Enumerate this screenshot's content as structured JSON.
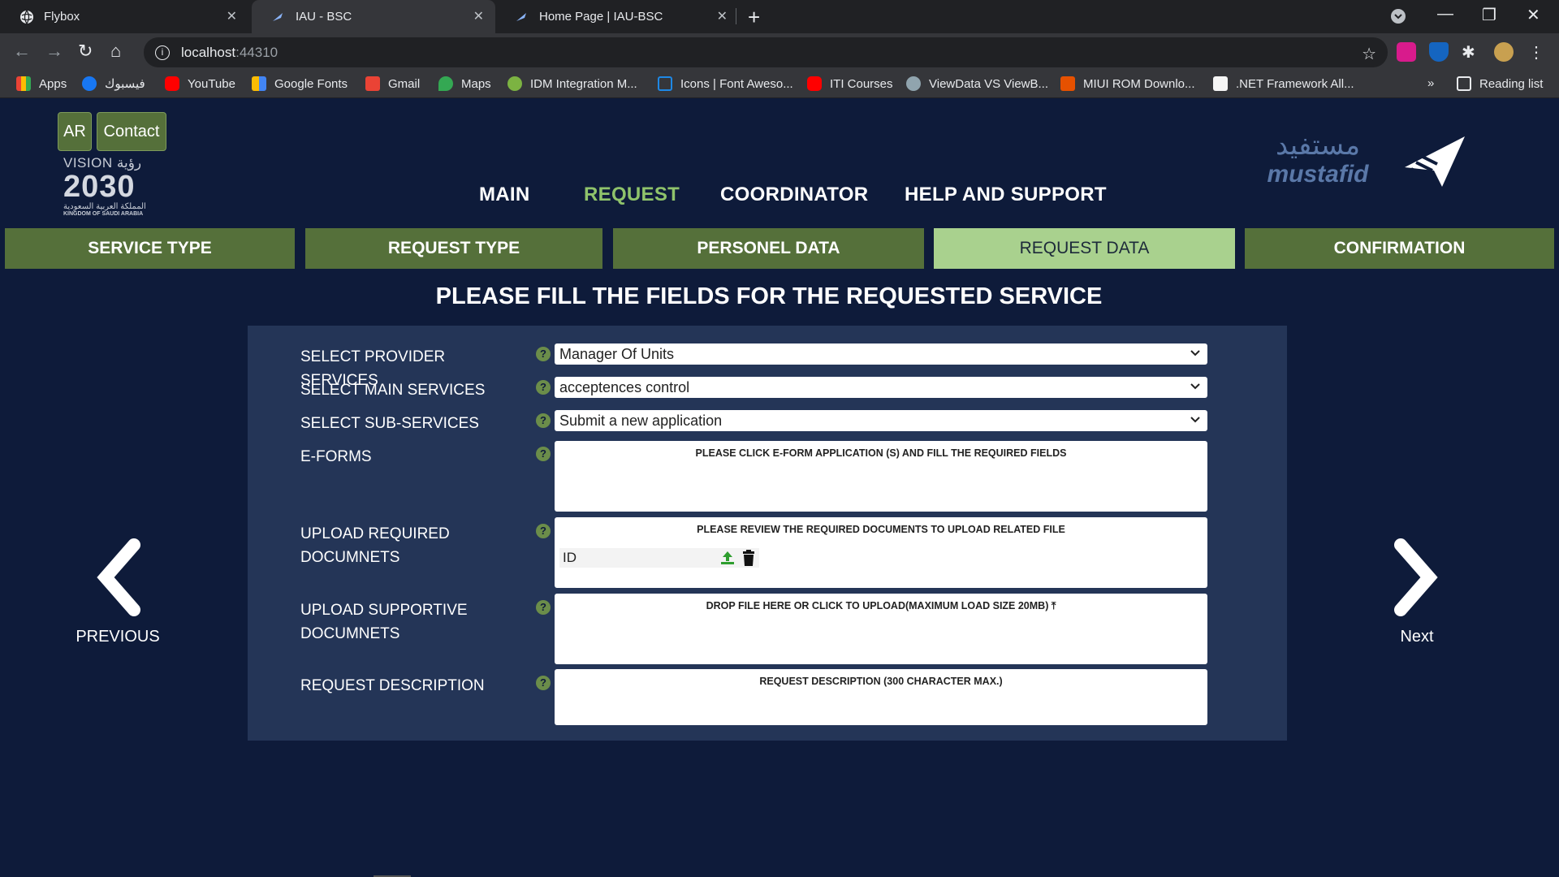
{
  "browser": {
    "tabs": [
      {
        "title": "Flybox",
        "active": false
      },
      {
        "title": "IAU - BSC",
        "active": true
      },
      {
        "title": "Home Page | IAU-BSC",
        "active": false
      }
    ],
    "url_host": "localhost",
    "url_port": ":44310",
    "bookmarks": [
      {
        "label": "Apps",
        "icon": "apps-grid-icon",
        "color": "#ea4335"
      },
      {
        "label": "فيسبوك",
        "icon": "facebook-icon",
        "color": "#1877f2"
      },
      {
        "label": "YouTube",
        "icon": "youtube-icon",
        "color": "#ff0000"
      },
      {
        "label": "Google Fonts",
        "icon": "google-fonts-icon",
        "color": "#fbbc04"
      },
      {
        "label": "Gmail",
        "icon": "gmail-icon",
        "color": "#ea4335"
      },
      {
        "label": "Maps",
        "icon": "maps-icon",
        "color": "#34a853"
      },
      {
        "label": "IDM Integration M...",
        "icon": "idm-icon",
        "color": "#7cb342"
      },
      {
        "label": "Icons | Font Aweso...",
        "icon": "flag-icon",
        "color": "#1e88e5"
      },
      {
        "label": "ITI Courses",
        "icon": "youtube-icon",
        "color": "#ff0000"
      },
      {
        "label": "ViewData VS ViewB...",
        "icon": "viewdata-icon",
        "color": "#90a4ae"
      },
      {
        "label": "MIUI ROM Downlo...",
        "icon": "miui-icon",
        "color": "#e65100"
      },
      {
        "label": ".NET Framework All...",
        "icon": "dotnet-icon",
        "color": "#f5f5f5"
      }
    ],
    "more_label": "»",
    "reading_list": "Reading list"
  },
  "header": {
    "ar_label": "AR",
    "contact_label": "Contact",
    "vision_word": "VISION",
    "vision_year": "2030",
    "vision_arabic": "رؤية",
    "vision_sub_ar": "المملكة العربية السعودية",
    "vision_sub_en": "KINGDOM OF SAUDI ARABIA",
    "brand_arabic": "مستفيد",
    "brand_latin": "mustafid",
    "nav": [
      {
        "label": "MAIN",
        "active": false
      },
      {
        "label": "REQUEST",
        "active": true
      },
      {
        "label": "COORDINATOR",
        "active": false
      },
      {
        "label": "HELP AND SUPPORT",
        "active": false
      }
    ]
  },
  "steps": [
    {
      "label": "SERVICE TYPE",
      "active": false
    },
    {
      "label": "REQUEST TYPE",
      "active": false
    },
    {
      "label": "PERSONEL DATA",
      "active": false
    },
    {
      "label": "REQUEST DATA",
      "active": true
    },
    {
      "label": "CONFIRMATION",
      "active": false
    }
  ],
  "form": {
    "title": "PLEASE FILL THE FIELDS FOR THE REQUESTED SERVICE",
    "provider_label": "SELECT PROVIDER SERVICES",
    "provider_value": "Manager Of Units",
    "main_label": "SELECT MAIN SERVICES",
    "main_value": "acceptences control",
    "sub_label": "SELECT SUB-SERVICES",
    "sub_value": "Submit a new application",
    "eforms_label": "E-FORMS",
    "eforms_hint": "PLEASE CLICK E-FORM APPLICATION (S) AND FILL THE REQUIRED FIELDS",
    "upload_required_label": "UPLOAD REQUIRED DOCUMNETS",
    "upload_required_hint": "PLEASE REVIEW THE REQUIRED DOCUMENTS TO UPLOAD RELATED FILE",
    "required_doc": "ID",
    "upload_supportive_label": "UPLOAD SUPPORTIVE DOCUMNETS",
    "upload_supportive_hint": "DROP FILE HERE OR CLICK TO UPLOAD(MAXIMUM LOAD SIZE 20MB)",
    "description_label": "REQUEST DESCRIPTION",
    "description_placeholder": "REQUEST DESCRIPTION (300 CHARACTER MAX.)",
    "help_glyph": "?"
  },
  "pager": {
    "previous_label": "PREVIOUS",
    "next_label": "Next"
  },
  "colors": {
    "page_bg": "#0e1b3a",
    "panel_bg": "#243557",
    "step_bg": "#55703a",
    "step_active_bg": "#a9d18e",
    "nav_active": "#8fc36b",
    "upload_green": "#2e9e2e"
  }
}
